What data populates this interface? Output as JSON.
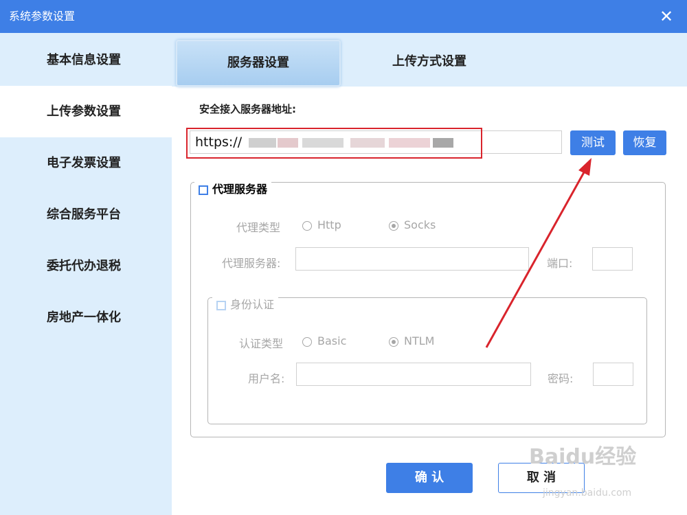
{
  "window": {
    "title": "系统参数设置",
    "close_glyph": "✕"
  },
  "sidebar": {
    "items": [
      {
        "label": "基本信息设置"
      },
      {
        "label": "上传参数设置"
      },
      {
        "label": "电子发票设置"
      },
      {
        "label": "综合服务平台"
      },
      {
        "label": "委托代办退税"
      },
      {
        "label": "房地产一体化"
      }
    ],
    "active_index": 1
  },
  "tabs": [
    {
      "label": "服务器设置",
      "active": true
    },
    {
      "label": "上传方式设置",
      "active": false
    }
  ],
  "server": {
    "address_label": "安全接入服务器地址:",
    "url_value": "https://",
    "test_button": "测试",
    "restore_button": "恢复"
  },
  "proxy": {
    "legend": "代理服务器",
    "checked": false,
    "type_label": "代理类型",
    "type_options": [
      "Http",
      "Socks"
    ],
    "type_selected": "Socks",
    "server_label": "代理服务器:",
    "server_value": "",
    "port_label": "端口:",
    "port_value": "",
    "auth": {
      "legend": "身份认证",
      "checked": false,
      "type_label": "认证类型",
      "type_options": [
        "Basic",
        "NTLM"
      ],
      "type_selected": "NTLM",
      "user_label": "用户名:",
      "user_value": "",
      "password_label": "密码:",
      "password_value": ""
    }
  },
  "footer": {
    "ok_label": "确 认",
    "cancel_label": "取 消"
  },
  "watermark": {
    "main": "Baidu经验",
    "sub": "jingyan.baidu.com"
  },
  "colors": {
    "accent": "#3e7fe6",
    "sidebar_bg": "#ddeefc",
    "highlight_red": "#d9242c"
  },
  "icons": {
    "close": "close-icon",
    "checkbox": "checkbox-icon",
    "radio": "radio-icon",
    "annotation_arrow": "arrow-annotation"
  }
}
